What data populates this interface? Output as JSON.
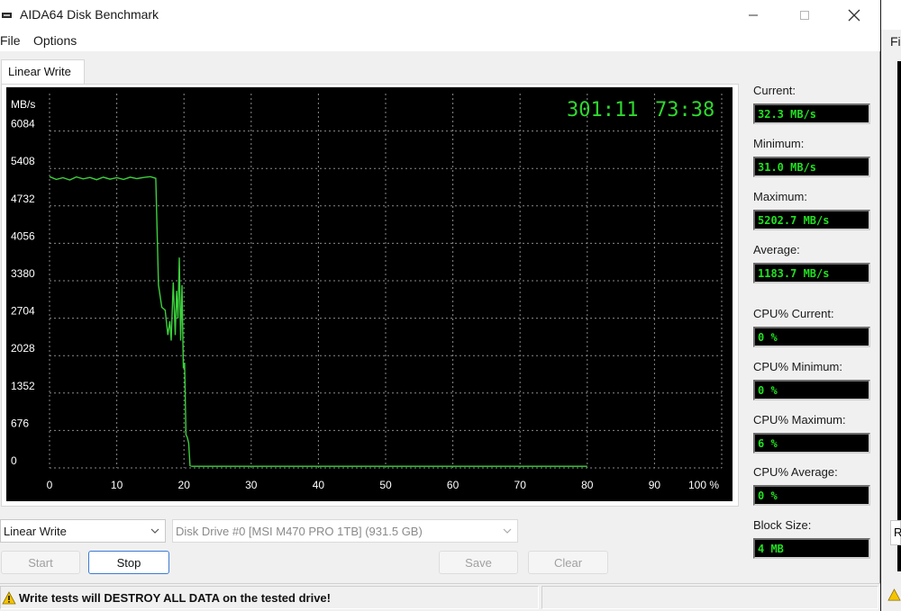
{
  "window": {
    "title": "AIDA64 Disk Benchmark",
    "minimize_icon": "minimize-icon",
    "maximize_icon": "maximize-icon",
    "close_icon": "close-icon"
  },
  "menu": {
    "items": [
      "File",
      "Options"
    ]
  },
  "tab": {
    "label": "Linear Write"
  },
  "chart_data": {
    "type": "line",
    "ylabel": "MB/s",
    "yticks": [
      0,
      676,
      1352,
      2028,
      2704,
      3380,
      4056,
      4732,
      5408,
      6084
    ],
    "xticks": [
      "0",
      "10",
      "20",
      "30",
      "40",
      "50",
      "60",
      "70",
      "80",
      "90",
      "100 %"
    ],
    "xlim": [
      0,
      100
    ],
    "ylim": [
      0,
      6760
    ],
    "grid": true,
    "overlay_time_elapsed": "301:11",
    "overlay_time_remaining": "73:38",
    "series": [
      {
        "color": "#3ccf3c",
        "x": [
          0,
          1,
          2,
          3,
          4,
          5,
          6,
          7,
          8,
          9,
          10,
          11,
          12,
          13,
          14,
          15,
          15.8,
          16.2,
          16.7,
          17.2,
          17.6,
          17.9,
          18.1,
          18.4,
          18.7,
          18.9,
          19.1,
          19.3,
          19.5,
          19.7,
          19.9,
          20.1,
          20.3,
          20.5,
          20.7,
          20.9,
          21.2,
          22,
          30,
          40,
          50,
          60,
          70,
          80
        ],
        "y": [
          5260,
          5210,
          5240,
          5200,
          5255,
          5220,
          5245,
          5205,
          5250,
          5215,
          5240,
          5210,
          5250,
          5225,
          5245,
          5260,
          5230,
          3300,
          2900,
          2850,
          2400,
          2650,
          2300,
          3350,
          2400,
          3200,
          2700,
          3800,
          2300,
          3300,
          1800,
          1900,
          600,
          550,
          450,
          40,
          30,
          30,
          30,
          30,
          30,
          30,
          30,
          30
        ]
      }
    ]
  },
  "stats": [
    {
      "label": "Current:",
      "value": "32.3 MB/s"
    },
    {
      "label": "Minimum:",
      "value": "31.0 MB/s"
    },
    {
      "label": "Maximum:",
      "value": "5202.7 MB/s"
    },
    {
      "label": "Average:",
      "value": "1183.7 MB/s"
    },
    {
      "label": "CPU% Current:",
      "value": "0 %"
    },
    {
      "label": "CPU% Minimum:",
      "value": "0 %"
    },
    {
      "label": "CPU% Maximum:",
      "value": "6 %"
    },
    {
      "label": "CPU% Average:",
      "value": "0 %"
    },
    {
      "label": "Block Size:",
      "value": "4 MB"
    }
  ],
  "controls": {
    "test_select": "Linear Write",
    "drive_select": "Disk Drive #0  [MSI M470 PRO 1TB]  (931.5 GB)",
    "start_label": "Start",
    "stop_label": "Stop",
    "save_label": "Save",
    "clear_label": "Clear"
  },
  "status": {
    "warning_icon": "warning-icon",
    "warning": "Write tests will DESTROY ALL DATA on the tested drive!"
  },
  "background_window": {
    "menu_fragment": "Fi",
    "box_fragment": "R"
  },
  "colors": {
    "chart_bg": "#000000",
    "grid": "#8a8a8a",
    "trace": "#3ccf3c",
    "overlay_text": "#2fd82f",
    "stat_text": "#21e021",
    "accent": "#3c7bd6"
  }
}
